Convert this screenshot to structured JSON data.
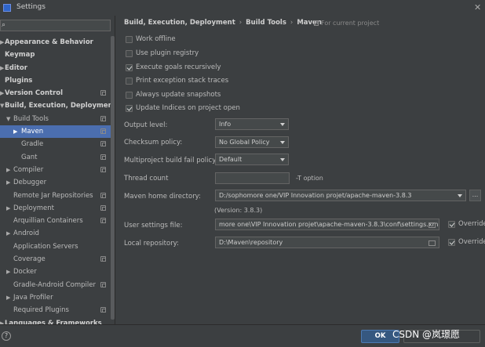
{
  "window": {
    "title": "Settings"
  },
  "sidebar": {
    "search_placeholder": "",
    "items": [
      {
        "label": "Appearance & Behavior",
        "bold": true,
        "arrow": "▶",
        "indent": 0,
        "cfg": false
      },
      {
        "label": "Keymap",
        "bold": true,
        "arrow": "",
        "indent": 0,
        "cfg": false
      },
      {
        "label": "Editor",
        "bold": true,
        "arrow": "▶",
        "indent": 0,
        "cfg": false
      },
      {
        "label": "Plugins",
        "bold": true,
        "arrow": "",
        "indent": 0,
        "cfg": false
      },
      {
        "label": "Version Control",
        "bold": true,
        "arrow": "▶",
        "indent": 0,
        "cfg": true
      },
      {
        "label": "Build, Execution, Deployment",
        "bold": true,
        "arrow": "▼",
        "indent": 0,
        "cfg": false
      },
      {
        "label": "Build Tools",
        "bold": false,
        "arrow": "▼",
        "indent": 1,
        "cfg": true
      },
      {
        "label": "Maven",
        "bold": false,
        "arrow": "▶",
        "indent": 2,
        "cfg": true,
        "selected": true
      },
      {
        "label": "Gradle",
        "bold": false,
        "arrow": "",
        "indent": 3,
        "cfg": true
      },
      {
        "label": "Gant",
        "bold": false,
        "arrow": "",
        "indent": 3,
        "cfg": true
      },
      {
        "label": "Compiler",
        "bold": false,
        "arrow": "▶",
        "indent": 1,
        "cfg": true
      },
      {
        "label": "Debugger",
        "bold": false,
        "arrow": "▶",
        "indent": 1,
        "cfg": false
      },
      {
        "label": "Remote Jar Repositories",
        "bold": false,
        "arrow": "",
        "indent": 1,
        "cfg": true
      },
      {
        "label": "Deployment",
        "bold": false,
        "arrow": "▶",
        "indent": 1,
        "cfg": true
      },
      {
        "label": "Arquillian Containers",
        "bold": false,
        "arrow": "",
        "indent": 1,
        "cfg": true
      },
      {
        "label": "Android",
        "bold": false,
        "arrow": "▶",
        "indent": 1,
        "cfg": false
      },
      {
        "label": "Application Servers",
        "bold": false,
        "arrow": "",
        "indent": 1,
        "cfg": false
      },
      {
        "label": "Coverage",
        "bold": false,
        "arrow": "",
        "indent": 1,
        "cfg": true
      },
      {
        "label": "Docker",
        "bold": false,
        "arrow": "▶",
        "indent": 1,
        "cfg": false
      },
      {
        "label": "Gradle-Android Compiler",
        "bold": false,
        "arrow": "",
        "indent": 1,
        "cfg": true
      },
      {
        "label": "Java Profiler",
        "bold": false,
        "arrow": "▶",
        "indent": 1,
        "cfg": false
      },
      {
        "label": "Required Plugins",
        "bold": false,
        "arrow": "",
        "indent": 1,
        "cfg": true
      },
      {
        "label": "Languages & Frameworks",
        "bold": true,
        "arrow": "▶",
        "indent": 0,
        "cfg": false
      }
    ]
  },
  "main": {
    "breadcrumb": [
      "Build, Execution, Deployment",
      "Build Tools",
      "Maven"
    ],
    "scope_note": "For current project",
    "checkboxes": [
      {
        "label": "Work offline",
        "checked": false
      },
      {
        "label": "Use plugin registry",
        "checked": false
      },
      {
        "label": "Execute goals recursively",
        "checked": true
      },
      {
        "label": "Print exception stack traces",
        "checked": false
      },
      {
        "label": "Always update snapshots",
        "checked": false
      },
      {
        "label": "Update Indices on project open",
        "checked": true
      }
    ],
    "output_level": {
      "label": "Output level:",
      "value": "Info"
    },
    "checksum_policy": {
      "label": "Checksum policy:",
      "value": "No Global Policy"
    },
    "fail_policy": {
      "label": "Multiproject build fail policy:",
      "value": "Default"
    },
    "thread_count": {
      "label": "Thread count",
      "value": "",
      "hint": "-T option"
    },
    "maven_home": {
      "label": "Maven home directory:",
      "value": "D:/sophomore one/VIP Innovation projet/apache-maven-3.8.3",
      "more": "...",
      "version": "(Version: 3.8.3)"
    },
    "user_settings": {
      "label": "User settings file:",
      "value": "more one\\VIP Innovation projet\\apache-maven-3.8.3\\conf\\settings.xml",
      "override_label": "Override",
      "override": true
    },
    "local_repo": {
      "label": "Local repository:",
      "value": "D:\\Maven\\repository",
      "override_label": "Override",
      "override": true
    }
  },
  "footer": {
    "help": "?",
    "ok_label": "OK",
    "watermark": "CSDN @岚璟愿"
  }
}
